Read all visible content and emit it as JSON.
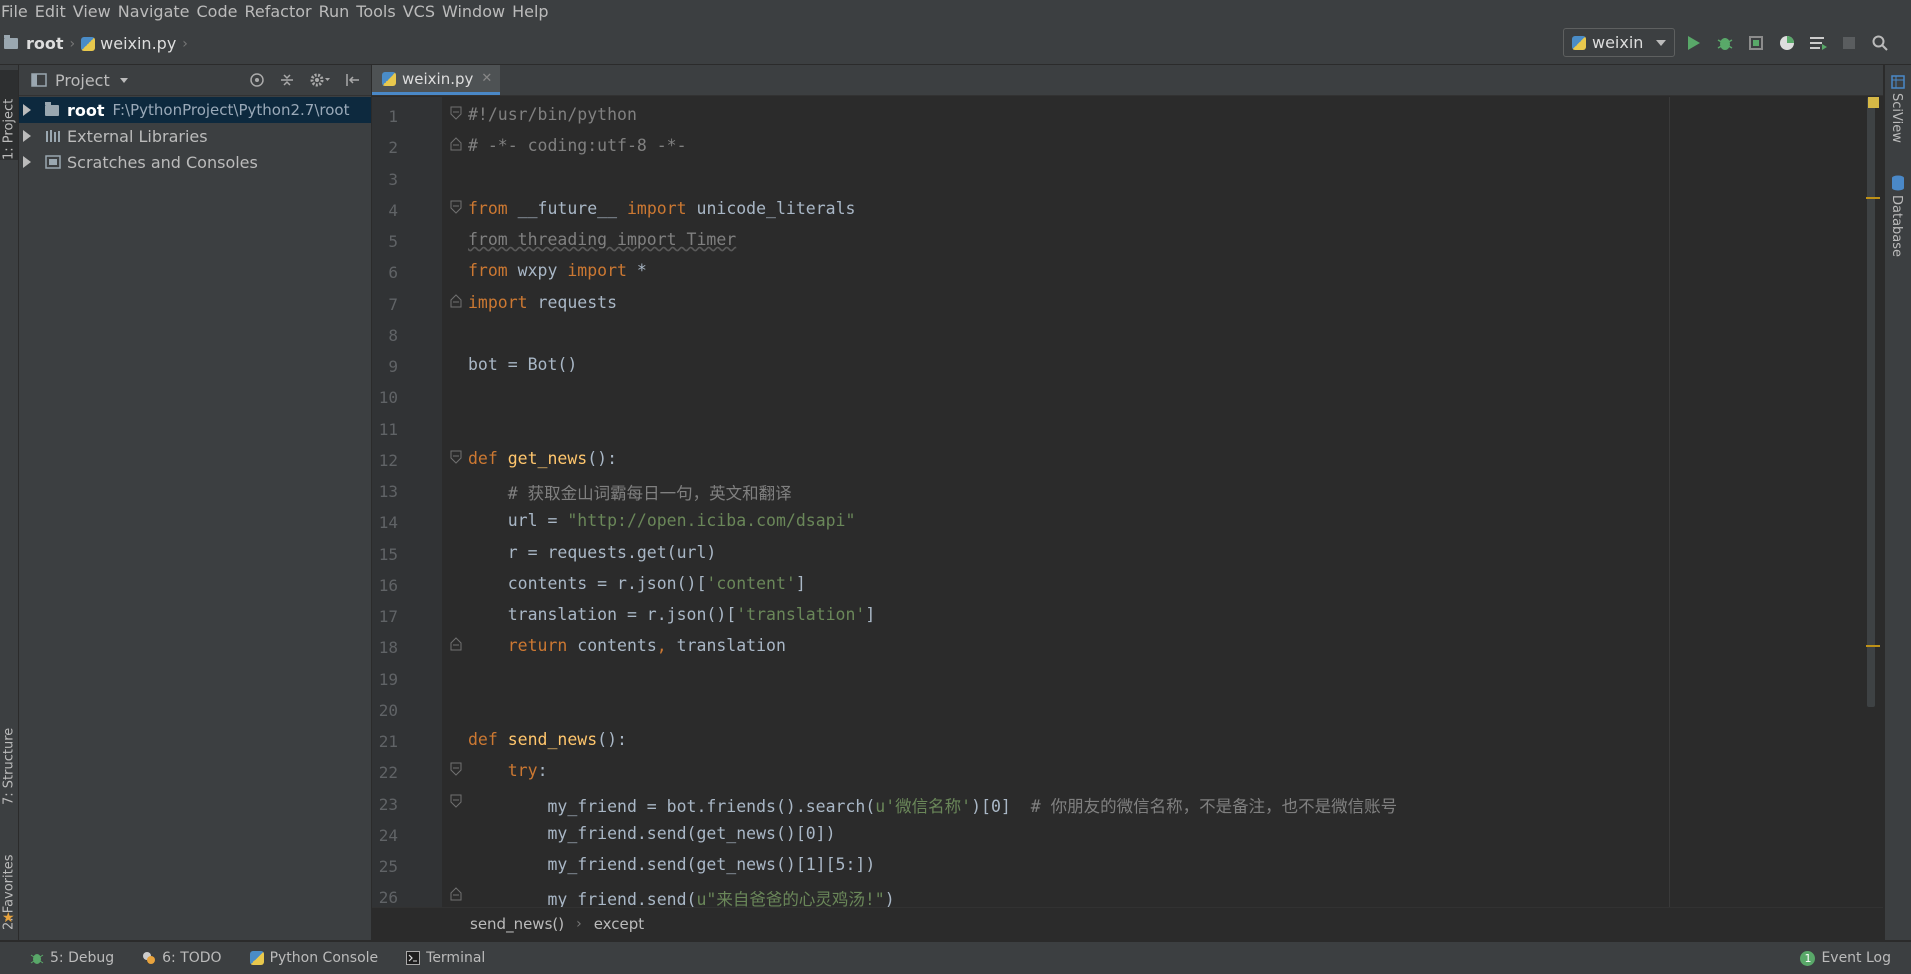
{
  "menu": [
    "File",
    "Edit",
    "View",
    "Navigate",
    "Code",
    "Refactor",
    "Run",
    "Tools",
    "VCS",
    "Window",
    "Help"
  ],
  "navbar": {
    "root": "root",
    "file": "weixin.py"
  },
  "run_config": {
    "label": "weixin"
  },
  "left_tabs": {
    "project": "1: Project",
    "structure": "7: Structure",
    "favorites": "2: Favorites"
  },
  "project_panel": {
    "title": "Project",
    "tree": [
      {
        "label": "root",
        "path": "F:\\PythonProject\\Python2.7\\root",
        "selected": true
      },
      {
        "label": "External Libraries"
      },
      {
        "label": "Scratches and Consoles"
      }
    ]
  },
  "editor": {
    "tab": "weixin.py",
    "breadcrumb": [
      "send_news()",
      "except"
    ],
    "line_numbers": [
      "1",
      "2",
      "3",
      "4",
      "5",
      "6",
      "7",
      "8",
      "9",
      "10",
      "11",
      "12",
      "13",
      "14",
      "15",
      "16",
      "17",
      "18",
      "19",
      "20",
      "21",
      "22",
      "23",
      "24",
      "25",
      "26"
    ]
  },
  "right_tabs": {
    "sciview": "SciView",
    "database": "Database"
  },
  "bottom_tabs": {
    "debug": "5: Debug",
    "todo": "6: TODO",
    "console": "Python Console",
    "terminal": "Terminal",
    "event_log": "Event Log",
    "event_count": "1"
  },
  "colors": {
    "keyword": "#cc7832",
    "string": "#6a8759",
    "comment": "#808080",
    "function": "#ffc66d",
    "selection": "#0d293e",
    "accent": "#4a88c7"
  }
}
